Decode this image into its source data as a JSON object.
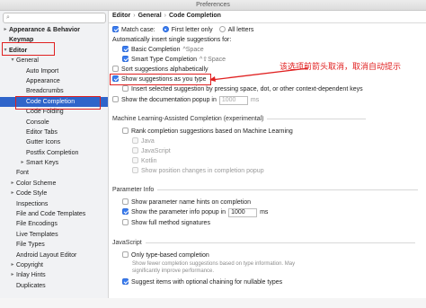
{
  "window": {
    "title": "Preferences"
  },
  "search": {
    "placeholder": ""
  },
  "sidebar": {
    "items": [
      {
        "label": "Appearance & Behavior",
        "arrow": "▸",
        "bold": true
      },
      {
        "label": "Keymap",
        "arrow": "",
        "bold": true
      },
      {
        "label": "Editor",
        "arrow": "▾",
        "bold": true
      },
      {
        "label": "General",
        "arrow": "▾",
        "bold": false
      },
      {
        "label": "Auto Import",
        "arrow": "",
        "bold": false
      },
      {
        "label": "Appearance",
        "arrow": "",
        "bold": false
      },
      {
        "label": "Breadcrumbs",
        "arrow": "",
        "bold": false
      },
      {
        "label": "Code Completion",
        "arrow": "",
        "bold": false
      },
      {
        "label": "Code Folding",
        "arrow": "",
        "bold": false
      },
      {
        "label": "Console",
        "arrow": "",
        "bold": false
      },
      {
        "label": "Editor Tabs",
        "arrow": "",
        "bold": false
      },
      {
        "label": "Gutter Icons",
        "arrow": "",
        "bold": false
      },
      {
        "label": "Postfix Completion",
        "arrow": "",
        "bold": false
      },
      {
        "label": "Smart Keys",
        "arrow": "▸",
        "bold": false
      },
      {
        "label": "Font",
        "arrow": "",
        "bold": false
      },
      {
        "label": "Color Scheme",
        "arrow": "▸",
        "bold": false
      },
      {
        "label": "Code Style",
        "arrow": "▸",
        "bold": false
      },
      {
        "label": "Inspections",
        "arrow": "",
        "bold": false
      },
      {
        "label": "File and Code Templates",
        "arrow": "",
        "bold": false
      },
      {
        "label": "File Encodings",
        "arrow": "",
        "bold": false
      },
      {
        "label": "Live Templates",
        "arrow": "",
        "bold": false
      },
      {
        "label": "File Types",
        "arrow": "",
        "bold": false
      },
      {
        "label": "Android Layout Editor",
        "arrow": "",
        "bold": false
      },
      {
        "label": "Copyright",
        "arrow": "▸",
        "bold": false
      },
      {
        "label": "Inlay Hints",
        "arrow": "▸",
        "bold": false
      },
      {
        "label": "Duplicates",
        "arrow": "",
        "bold": false
      }
    ]
  },
  "breadcrumb": [
    "Editor",
    "General",
    "Code Completion"
  ],
  "main": {
    "match_case": {
      "label": "Match case:",
      "checked": true
    },
    "first_letter": {
      "label": "First letter only",
      "selected": true
    },
    "all_letters": {
      "label": "All letters",
      "selected": false
    },
    "auto_insert_heading": "Automatically insert single suggestions for:",
    "basic_completion": {
      "label": "Basic Completion",
      "shortcut": "^Space",
      "checked": true
    },
    "smart_completion": {
      "label": "Smart Type Completion",
      "shortcut": "^⇧Space",
      "checked": true
    },
    "sort_alpha": {
      "label": "Sort suggestions alphabetically",
      "checked": false
    },
    "show_as_type": {
      "label": "Show suggestions as you type",
      "checked": true
    },
    "insert_selected": {
      "label": "Insert selected suggestion by pressing space, dot, or other context-dependent keys",
      "checked": false
    },
    "doc_popup": {
      "label": "Show the documentation popup in",
      "value": "1000",
      "unit": "ms",
      "checked": false
    },
    "ml_section": "Machine Learning-Assisted Completion (experimental)",
    "ml_rank": {
      "label": "Rank completion suggestions based on Machine Learning",
      "checked": false
    },
    "ml_java": {
      "label": "Java",
      "checked": false
    },
    "ml_js": {
      "label": "JavaScript",
      "checked": false
    },
    "ml_kotlin": {
      "label": "Kotlin",
      "checked": false
    },
    "ml_show_pos": {
      "label": "Show position changes in completion popup",
      "checked": false
    },
    "param_section": "Parameter Info",
    "param_hints": {
      "label": "Show parameter name hints on completion",
      "checked": false
    },
    "param_popup": {
      "label": "Show the parameter info popup in",
      "value": "1000",
      "unit": "ms",
      "checked": true
    },
    "full_sig": {
      "label": "Show full method signatures",
      "checked": false
    },
    "js_section": "JavaScript",
    "type_based": {
      "label": "Only type-based completion",
      "checked": false
    },
    "type_based_desc1": "Show fewer completion suggestions based on type information. May",
    "type_based_desc2": "significantly improve performance.",
    "optional_chaining": {
      "label": "Suggest items with optional chaining for nullable types",
      "checked": true
    }
  },
  "annotation": {
    "text": "该选项前箭头取消，取消自动提示",
    "color": "#e02020"
  },
  "colors": {
    "selection": "#2f65ca",
    "accent": "#3a7df0",
    "annotation_box": "#e02020"
  }
}
